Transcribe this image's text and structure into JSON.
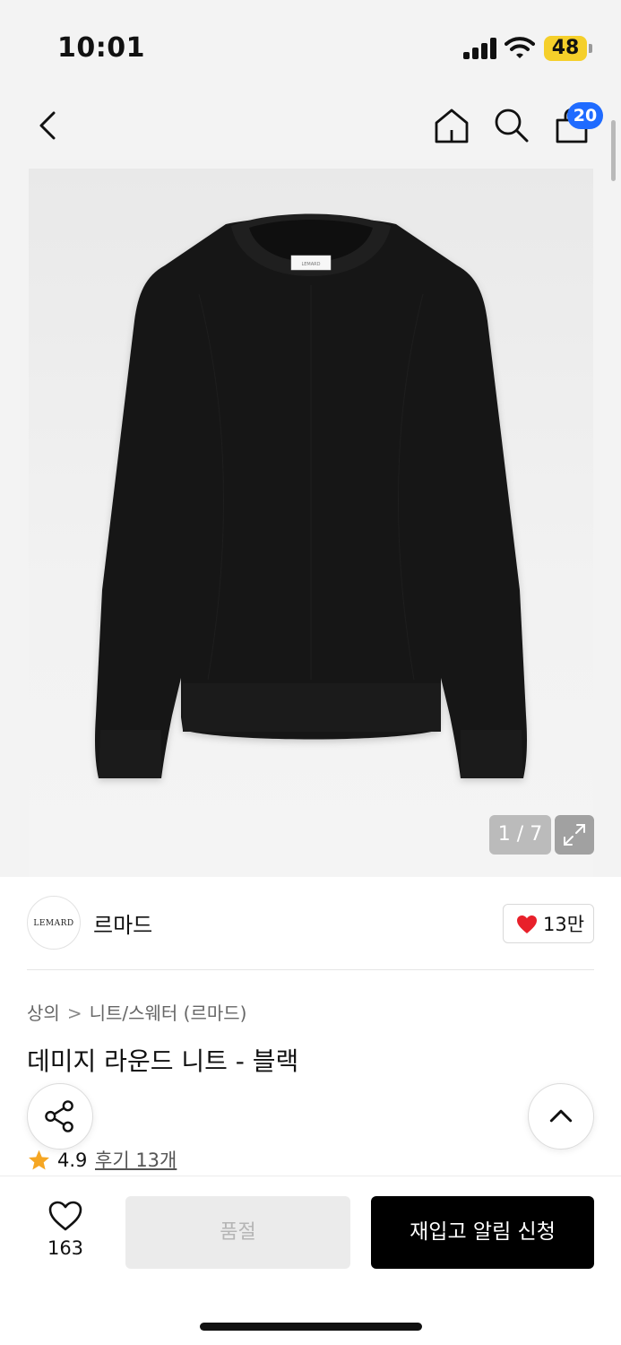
{
  "status_bar": {
    "time": "10:01",
    "battery": "48",
    "icons": [
      "signal-icon",
      "wifi-icon",
      "battery-icon"
    ]
  },
  "nav": {
    "icons": [
      "back-icon",
      "home-icon",
      "search-icon",
      "shopping-bag-icon"
    ],
    "cart_count": "20"
  },
  "gallery": {
    "counter": "1 / 7",
    "current_image": 1,
    "total_images": 7,
    "image_subject": "black round-neck knit sweater",
    "label_text": "LEMARD"
  },
  "brand": {
    "logo_text": "LEMARD",
    "name": "르마드",
    "likes": "13만"
  },
  "product": {
    "breadcrumb": [
      "상의",
      "니트/스웨터 (르마드)"
    ],
    "breadcrumb_separator": ">",
    "title": "데미지 라운드 니트 - 블랙"
  },
  "rating": {
    "score": "4.9",
    "review_link": "후기 13개",
    "star_color": "#f5a623"
  },
  "actions": {
    "wish_count": "163",
    "soldout_label": "품절",
    "restock_label": "재입고 알림 신청"
  },
  "colors": {
    "accent_badge": "#1f6bff",
    "heart": "#e8202a",
    "primary_button": "#000000"
  }
}
